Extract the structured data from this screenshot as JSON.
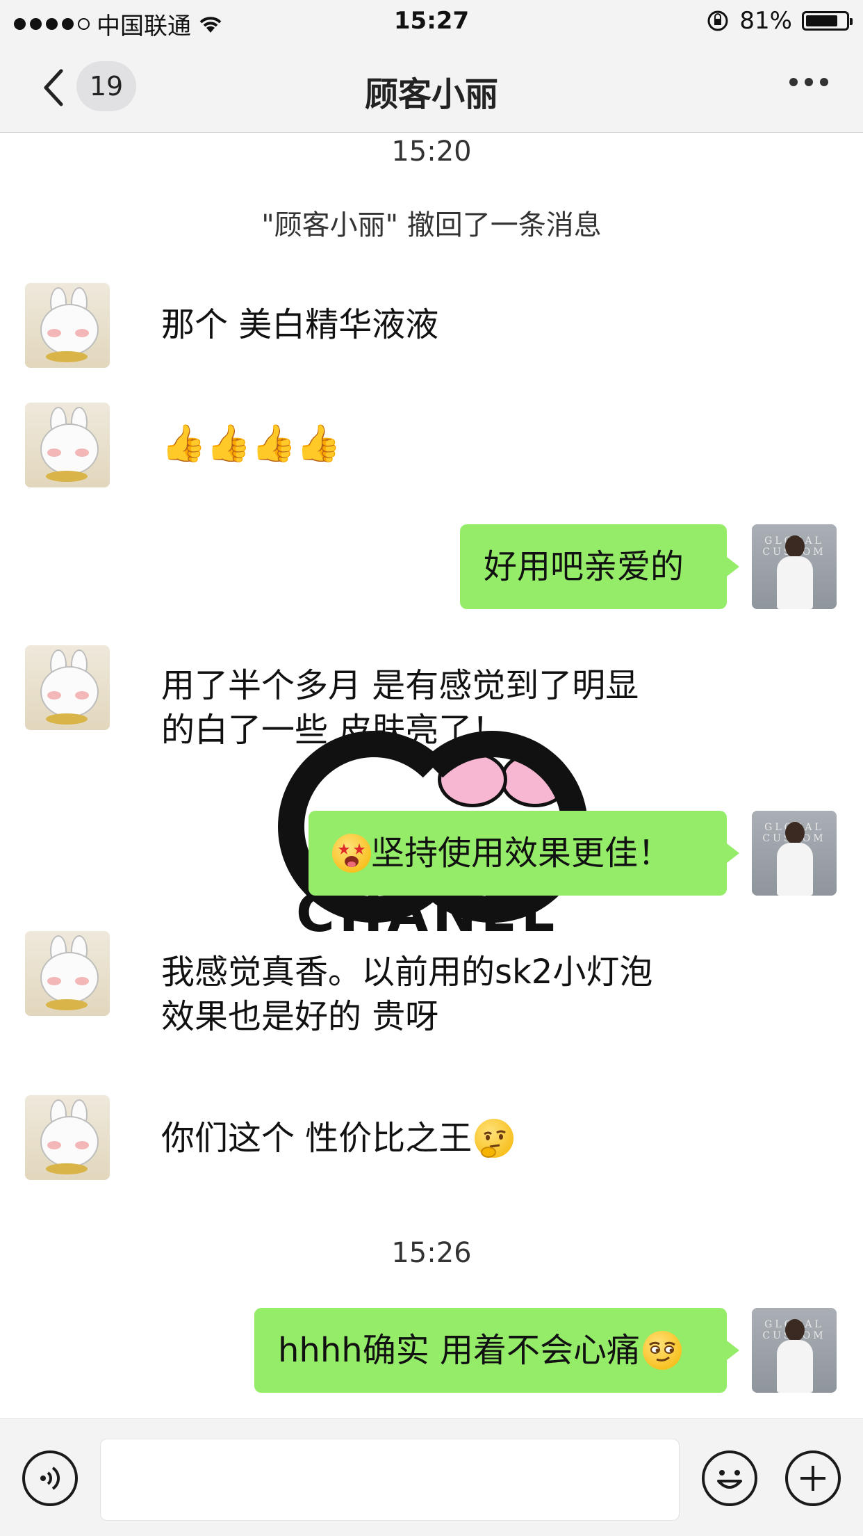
{
  "status_bar": {
    "carrier": "中国联通",
    "time": "15:27",
    "battery_text": "81%",
    "battery_level": 0.81
  },
  "nav": {
    "unread_count": "19",
    "title": "顾客小丽"
  },
  "chat": {
    "time_1": "15:20",
    "system_message": "\"顾客小丽\" 撤回了一条消息",
    "messages": [
      {
        "side": "left",
        "text": "那个 美白精华液液"
      },
      {
        "side": "left",
        "text": "👍👍👍👍"
      },
      {
        "side": "right",
        "text": "好用吧亲爱的"
      },
      {
        "side": "left",
        "line1": "用了半个多月 是有感觉到了明显",
        "line2": "的白了一些 皮肤亮了！"
      },
      {
        "side": "right",
        "text": "坚持使用效果更佳！"
      },
      {
        "side": "left",
        "line1": "我感觉真香。以前用的sk2小灯泡",
        "line2": "效果也是好的 贵呀"
      },
      {
        "side": "left",
        "text": "你们这个 性价比之王"
      },
      {
        "side": "right",
        "text": "hhhh确实 用着不会心痛"
      }
    ],
    "time_2": "15:26",
    "sticker_text": "CHANEL",
    "avatar_girl_text": "GLOBAL CUSTOM"
  },
  "input_bar": {
    "placeholder": ""
  },
  "icons": {
    "back": "chevron-left-icon",
    "more": "more-dots-icon",
    "voice": "voice-icon",
    "emoji": "emoji-face-icon",
    "plus": "plus-icon"
  },
  "colors": {
    "bubble_green": "#95ec69",
    "bar_gray": "#f3f3f4"
  }
}
